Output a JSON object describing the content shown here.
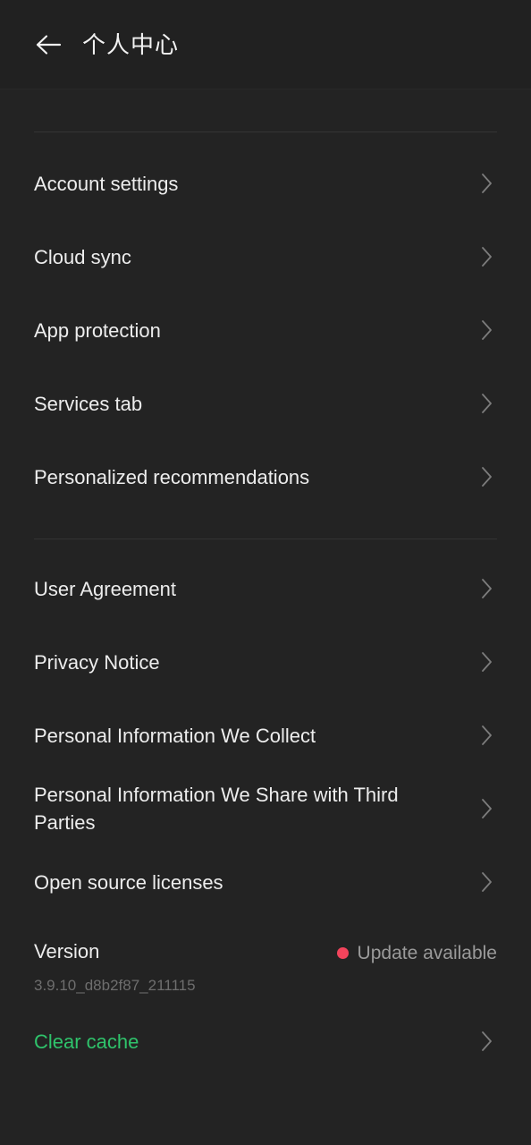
{
  "header": {
    "title": "个人中心",
    "back_icon": "arrow-left-icon"
  },
  "colors": {
    "background": "#232323",
    "appbar_background": "#212121",
    "primary_text": "#ededed",
    "secondary_text": "#9a9a9a",
    "muted_text": "#6e6e6e",
    "divider": "#343434",
    "accent_green": "#2fc36b",
    "badge_red": "#f2445c",
    "chevron": "#8c8c8c"
  },
  "groups": [
    {
      "name": "settings-group",
      "items": [
        {
          "label": "Account settings",
          "chevron": "chevron-right-icon"
        },
        {
          "label": "Cloud sync",
          "chevron": "chevron-right-icon"
        },
        {
          "label": "App protection",
          "chevron": "chevron-right-icon"
        },
        {
          "label": "Services tab",
          "chevron": "chevron-right-icon"
        },
        {
          "label": "Personalized recommendations",
          "chevron": "chevron-right-icon"
        }
      ]
    },
    {
      "name": "legal-group",
      "items": [
        {
          "label": "User Agreement",
          "chevron": "chevron-right-icon"
        },
        {
          "label": "Privacy Notice",
          "chevron": "chevron-right-icon"
        },
        {
          "label": "Personal Information We Collect",
          "chevron": "chevron-right-icon"
        },
        {
          "label": "Personal Information We Share with Third Parties",
          "chevron": "chevron-right-icon"
        },
        {
          "label": "Open source licenses",
          "chevron": "chevron-right-icon"
        }
      ]
    }
  ],
  "version": {
    "title": "Version",
    "code": "3.9.10_d8b2f87_211115",
    "update_status": "Update available",
    "update_dot": "update-available-dot"
  },
  "clear_cache": {
    "label": "Clear cache",
    "chevron": "chevron-right-icon"
  }
}
